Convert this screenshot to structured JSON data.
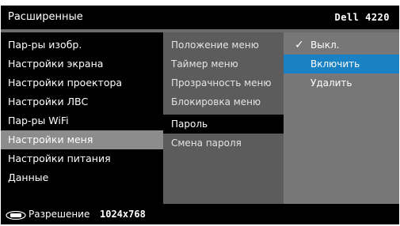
{
  "header": {
    "title": "Расширенные",
    "model": "Dell 4220"
  },
  "menu": {
    "items": [
      {
        "label": "Пар-ры изобр."
      },
      {
        "label": "Настройки экрана"
      },
      {
        "label": "Настройки проектора"
      },
      {
        "label": "Настройки ЛВС"
      },
      {
        "label": "Пар-ры WiFi"
      },
      {
        "label": "Настройки меня",
        "selected": true
      },
      {
        "label": "Настройки питания"
      },
      {
        "label": "Данные"
      }
    ]
  },
  "submenu": {
    "items": [
      {
        "label": "Положение меню"
      },
      {
        "label": "Таймер меню"
      },
      {
        "label": "Прозрачность меню"
      },
      {
        "label": "Блокировка меню"
      },
      {
        "label": "Пароль",
        "active": true
      },
      {
        "label": "Смена пароля"
      }
    ]
  },
  "options": {
    "items": [
      {
        "label": "Выкл.",
        "checked": true
      },
      {
        "label": "Включить",
        "highlight": true
      },
      {
        "label": "Удалить"
      }
    ]
  },
  "footer": {
    "icon": "display-icon",
    "resolution_label": "Разрешение",
    "resolution_value": "1024x768"
  },
  "colors": {
    "background": "#000000",
    "submenu_bg": "#5c5c5c",
    "options_bg": "#777777",
    "selected_item": "#8c8c8c",
    "highlight": "#1a82c4"
  }
}
